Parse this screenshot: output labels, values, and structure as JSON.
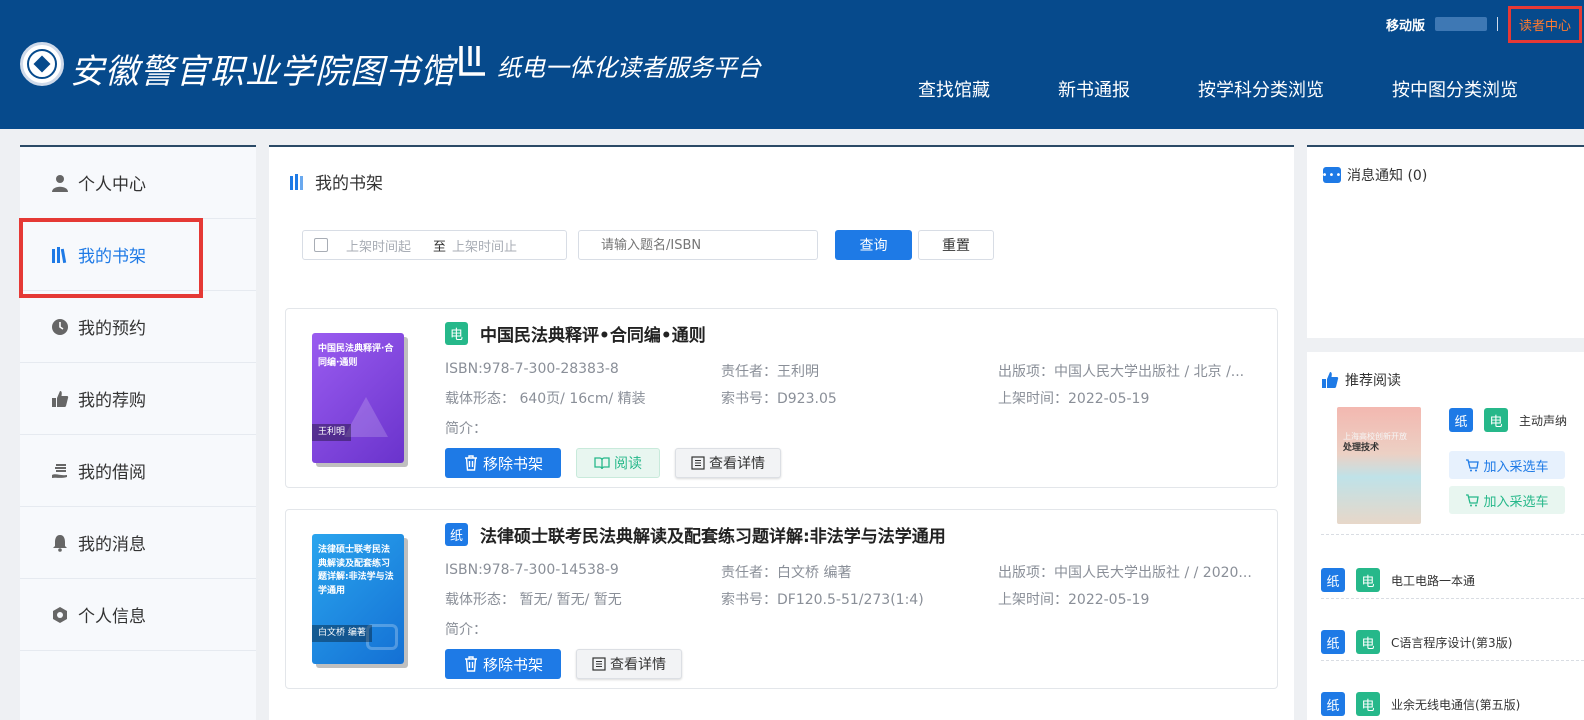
{
  "header": {
    "library_name": "安徽警官职业学院图书馆",
    "platform_name": "纸电一体化读者服务平台",
    "mobile_label": "移动版",
    "reader_center_label": "读者中心",
    "nav": [
      "查找馆藏",
      "新书通报",
      "按学科分类浏览",
      "按中图分类浏览"
    ]
  },
  "sidebar": {
    "items": [
      {
        "label": "个人中心",
        "icon": "user-icon"
      },
      {
        "label": "我的书架",
        "icon": "bookshelf-icon",
        "active": true
      },
      {
        "label": "我的预约",
        "icon": "clock-icon"
      },
      {
        "label": "我的荐购",
        "icon": "thumbs-up-icon"
      },
      {
        "label": "我的借阅",
        "icon": "hand-book-icon"
      },
      {
        "label": "我的消息",
        "icon": "bell-icon"
      },
      {
        "label": "个人信息",
        "icon": "hexagon-icon"
      }
    ]
  },
  "main": {
    "title": "我的书架",
    "filter": {
      "date_start_placeholder": "上架时间起",
      "date_sep": "至",
      "date_end_placeholder": "上架时间止",
      "search_placeholder": "请输入题名/ISBN",
      "query_label": "查询",
      "reset_label": "重置"
    },
    "books": [
      {
        "type": "电",
        "title": "中国民法典释评•合同编•通则",
        "cover_title": "中国民法典释评·合同编·通则",
        "cover_author": "王利明",
        "isbn": "ISBN:978-7-300-28383-8",
        "author": "责任者：王利明",
        "publisher": "出版项：中国人民大学出版社 / 北京 /...",
        "form": "载体形态： 640页/ 16cm/ 精装",
        "call_no": "索书号：D923.05",
        "shelf_date": "上架时间：2022-05-19",
        "intro": "简介：",
        "remove_label": "移除书架",
        "read_label": "阅读",
        "detail_label": "查看详情"
      },
      {
        "type": "纸",
        "title": "法律硕士联考民法典解读及配套练习题详解:非法学与法学通用",
        "cover_title": "法律硕士联考民法典解读及配套练习题详解:非法学与法学通用",
        "cover_author": "白文桥 编著",
        "isbn": "ISBN:978-7-300-14538-9",
        "author": "责任者：白文桥 编著",
        "publisher": "出版项：中国人民大学出版社 / / 2020...",
        "form": "载体形态： 暂无/ 暂无/ 暂无",
        "call_no": "索书号：DF120.5-51/273(1:4)",
        "shelf_date": "上架时间：2022-05-19",
        "intro": "简介：",
        "remove_label": "移除书架",
        "detail_label": "查看详情"
      }
    ]
  },
  "messages": {
    "title": "消息通知 (0)"
  },
  "recommend": {
    "title": "推荐阅读",
    "featured": {
      "cover_title": "上海高校创新开放",
      "cover_sub": "处理技术",
      "badge_paper": "纸",
      "badge_e": "电",
      "name": "主动声纳",
      "cart_label": "加入采选车"
    },
    "list": [
      {
        "badge_paper": "纸",
        "badge_e": "电",
        "name": "电工电路一本通"
      },
      {
        "badge_paper": "纸",
        "badge_e": "电",
        "name": "C语言程序设计(第3版)"
      },
      {
        "badge_paper": "纸",
        "badge_e": "电",
        "name": "业余无线电通信(第五版)"
      }
    ]
  },
  "colors": {
    "header_bg": "#064a8c",
    "accent_blue": "#1e7ae6",
    "accent_green": "#26b88a",
    "reader_center": "#ff7a2e",
    "highlight_red": "#e53935"
  }
}
